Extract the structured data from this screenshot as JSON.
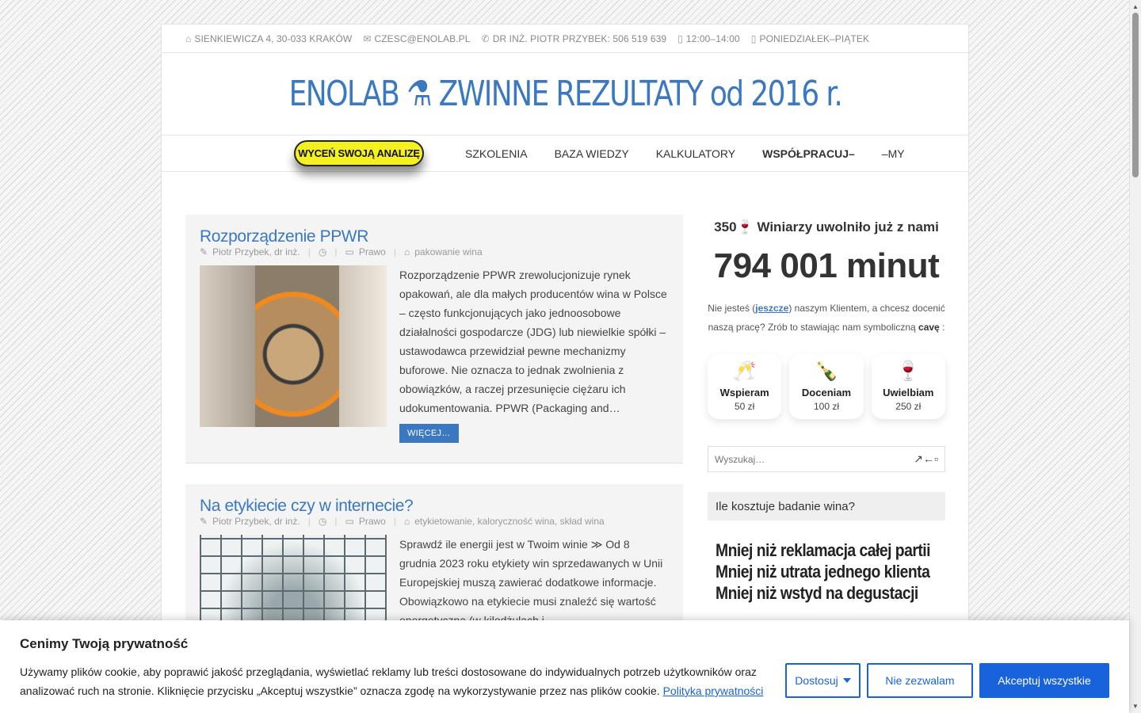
{
  "topbar": {
    "address": "SIENKIEWICZA 4, 30-033 KRAKÓW",
    "email": "CZESC@ENOLAB.PL",
    "phone": "DR INŻ. PIOTR PRZYBEK: 506 519 639",
    "hours": "12:00–14:00",
    "days": "PONIEDZIAŁEK–PIĄTEK"
  },
  "header": {
    "title": "ENOLAB ⚗ ZWINNE REZULTATY od 2016 r."
  },
  "nav": {
    "cta": "WYCEŃ SWOJĄ ANALIZĘ",
    "items": [
      "SZKOLENIA",
      "BAZA WIEDZY",
      "KALKULATORY",
      "WSPÓŁPRACUJ–",
      "–MY"
    ]
  },
  "posts": [
    {
      "title": "Rozporządzenie PPWR",
      "author": "Piotr Przybek, dr inż.",
      "category": "Prawo",
      "tags": "pakowanie wina",
      "excerpt": "Rozporządzenie PPWR zrewolucjonizuje rynek opakowań, ale dla małych producentów wina w Polsce – często funkcjonujących jako jednoosobowe działalności gospodarcze (JDG) lub niewielkie spółki – ustawodawca przewidział pewne mechanizmy buforowe. Nie oznacza to jednak zwolnienia z obowiązków, a raczej przesunięcie ciężaru ich udokumentowania. PPWR (Packaging and…",
      "more": "WIĘCEJ…"
    },
    {
      "title": "Na etykiecie czy w internecie?",
      "author": "Piotr Przybek, dr inż.",
      "category": "Prawo",
      "tags": "etykietowanie, kaloryczność wina, skład wina",
      "excerpt": "Sprawdź ile energii jest w Twoim winie ≫   Od 8 grudnia 2023 roku etykiety win sprzedawanych w Unii Europejskiej muszą zawierać dodatkowe informacje. Obowiązkowo na etykiecie musi znaleźć się wartość energetyczna (w kilodżulach i"
    }
  ],
  "sidebar": {
    "counter_title": "350🍷 Winiarzy uwolniło już z nami",
    "counter_value": "794 001 minut",
    "support_pre": "Nie jesteś (",
    "support_link": "jeszcze",
    "support_mid": ") naszym Klientem, a chcesz docenić naszą pracę? Zrób to stawiając nam symboliczną ",
    "support_bold": "cavę",
    "support_post": " :",
    "tiers": [
      {
        "icon": "🥂",
        "name": "Wspieram",
        "price": "50 zł"
      },
      {
        "icon": "🍾",
        "name": "Doceniam",
        "price": "100 zł"
      },
      {
        "icon": "🍷",
        "name": "Uwielbiam",
        "price": "250 zł"
      }
    ],
    "search_placeholder": "Wyszukaj…",
    "widget_title": "Ile kosztuje badanie wina?",
    "widget_lines": [
      "Mniej niż reklamacja całej partii",
      "Mniej niż utrata jednego klienta",
      "Mniej niż wstyd na degustacji"
    ]
  },
  "cookie": {
    "title": "Cenimy Twoją prywatność",
    "text": "Używamy plików cookie, aby poprawić jakość przeglądania, wyświetlać reklamy lub treści dostosowane do indywidualnych potrzeb użytkowników oraz analizować ruch na stronie. Kliknięcie przycisku „Akceptuj wszystkie” oznacza zgodę na wykorzystywanie przez nas plików cookie.",
    "policy_link": "Polityka prywatności",
    "customize": "Dostosuj",
    "reject": "Nie zezwalam",
    "accept": "Akceptuj wszystkie"
  },
  "colors": {
    "accent": "#3a78c2",
    "cta": "#f5f01f",
    "cookie_button": "#1863dc"
  }
}
